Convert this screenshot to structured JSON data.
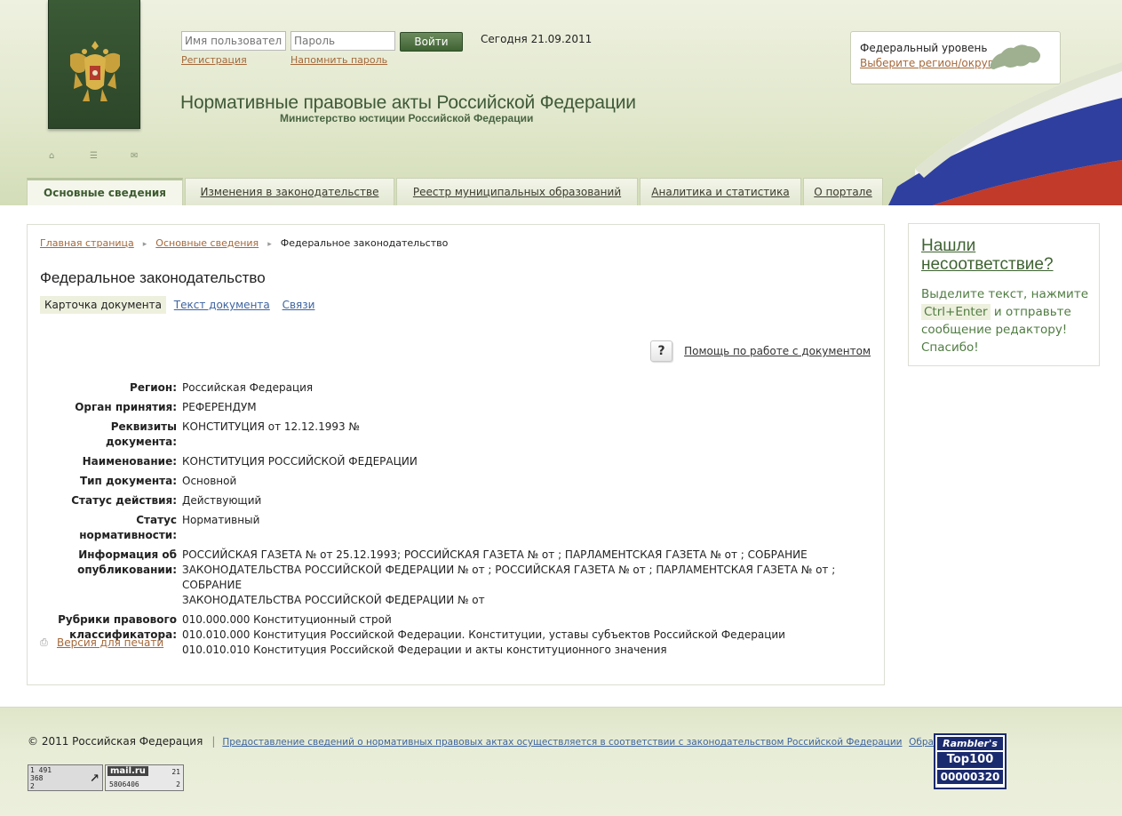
{
  "login": {
    "username_placeholder": "Имя пользователя",
    "password_placeholder": "Пароль",
    "submit_label": "Войти",
    "register_link": "Регистрация",
    "remind_link": "Напомнить пароль"
  },
  "today": "Сегодня 21.09.2011",
  "site": {
    "title": "Нормативные правовые акты Российской Федерации",
    "subtitle": "Министерство юстиции Российской Федерации"
  },
  "region": {
    "level": "Федеральный уровень",
    "select_link": "Выберите регион/округ"
  },
  "mini_icons": [
    "home-icon",
    "sitemap-icon",
    "mail-icon"
  ],
  "nav": {
    "items": [
      {
        "label": "Основные сведения",
        "active": true
      },
      {
        "label": "Изменения в законодательстве",
        "active": false
      },
      {
        "label": "Реестр муниципальных образований",
        "active": false
      },
      {
        "label": "Аналитика и статистика",
        "active": false
      },
      {
        "label": "О портале",
        "active": false
      }
    ]
  },
  "breadcrumb": {
    "home": "Главная страница",
    "section": "Основные сведения",
    "current": "Федеральное законодательство"
  },
  "page_title": "Федеральное законодательство",
  "tabs": {
    "card": "Карточка документа",
    "text": "Текст документа",
    "links": "Связи"
  },
  "help": {
    "icon": "?",
    "label": "Помощь по работе с документом"
  },
  "fields": [
    {
      "key": "Регион:",
      "value": "Российская Федерация"
    },
    {
      "key": "Орган принятия:",
      "value": "РЕФЕРЕНДУМ"
    },
    {
      "key": "Реквизиты документа:",
      "value": "КОНСТИТУЦИЯ от 12.12.1993 №"
    },
    {
      "key": "Наименование:",
      "value": "КОНСТИТУЦИЯ РОССИЙСКОЙ ФЕДЕРАЦИИ"
    },
    {
      "key": "Тип документа:",
      "value": "Основной"
    },
    {
      "key": "Статус действия:",
      "value": "Действующий"
    },
    {
      "key": "Статус нормативности:",
      "value": "Нормативный"
    }
  ],
  "publication": {
    "key_line1": "Информация об",
    "key_line2": "опубликовании:",
    "value_line1": "РОССИЙСКАЯ ГАЗЕТА № от 25.12.1993; РОССИЙСКАЯ ГАЗЕТА № от ; ПАРЛАМЕНТСКАЯ ГАЗЕТА № от ; СОБРАНИЕ",
    "value_line2": "ЗАКОНОДАТЕЛЬСТВА РОССИЙСКОЙ ФЕДЕРАЦИИ № от ; РОССИЙСКАЯ ГАЗЕТА № от ; ПАРЛАМЕНТСКАЯ ГАЗЕТА № от ; СОБРАНИЕ",
    "value_line3": "ЗАКОНОДАТЕЛЬСТВА РОССИЙСКОЙ ФЕДЕРАЦИИ № от"
  },
  "rubrics": {
    "key_line1": "Рубрики правового",
    "key_line2": "классификатора:",
    "items": [
      "010.000.000 Конституционный строй",
      "010.010.000 Конституция Российской Федерации. Конституции, уставы субъектов Российской Федерации",
      "010.010.010 Конституция Российской Федерации и акты конституционного значения"
    ]
  },
  "print_link": "Версия для печати",
  "feedback": {
    "title_line1": "Нашли",
    "title_line2": "несоответствие?",
    "text_before": "Выделите текст, нажмите",
    "shortcut": "Ctrl+Enter",
    "text_after": "и отправьте сообщение редактору! Спасибо!"
  },
  "footer": {
    "copyright": "© 2011 Российская Федерация",
    "separator": "|",
    "legal_link": "Предоставление сведений о нормативных правовых актах осуществляется в соответствии с законодательством Российской Федерации",
    "feedback_link": "Обратная связь",
    "counter1": {
      "line1": "1 491",
      "line2": "368",
      "line3": "2"
    },
    "counter2": {
      "brand": "mail.ru",
      "number": "5806406",
      "top": "21",
      "bottom": "2"
    },
    "rambler": {
      "line1": "Rambler's",
      "line2": "Top100",
      "line3": "00000320"
    }
  },
  "colors": {
    "header_green": "#e2e8cd",
    "emblem_green": "#2c4629",
    "link_brown": "#a5683a",
    "link_blue": "#3e64a0",
    "feedback_green": "#507c42"
  }
}
